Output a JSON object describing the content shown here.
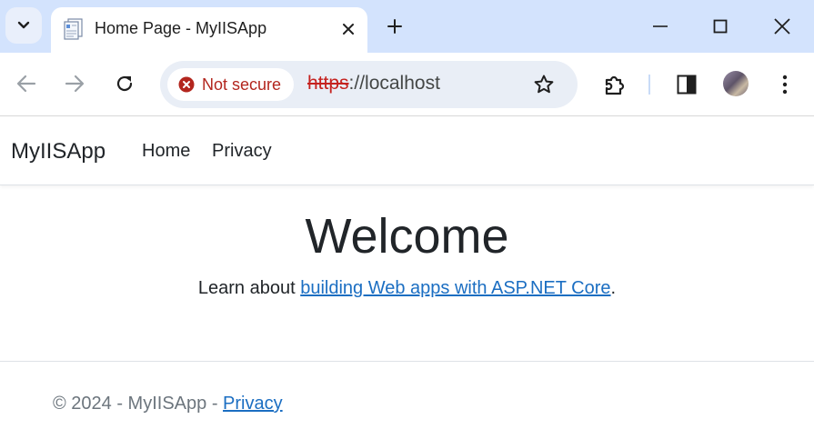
{
  "browser": {
    "tab_title": "Home Page - MyIISApp",
    "url_scheme": "https",
    "url_rest": "://localhost",
    "security_label": "Not secure"
  },
  "site": {
    "brand": "MyIISApp",
    "nav": [
      "Home",
      "Privacy"
    ],
    "heading": "Welcome",
    "learn_prefix": "Learn about ",
    "learn_link": "building Web apps with ASP.NET Core",
    "learn_suffix": ".",
    "footer_text": "© 2024 - MyIISApp - ",
    "footer_link": "Privacy"
  },
  "colors": {
    "tabstrip": "#d3e3fd",
    "link": "#1b6ec2",
    "not_secure": "#b3261e"
  }
}
